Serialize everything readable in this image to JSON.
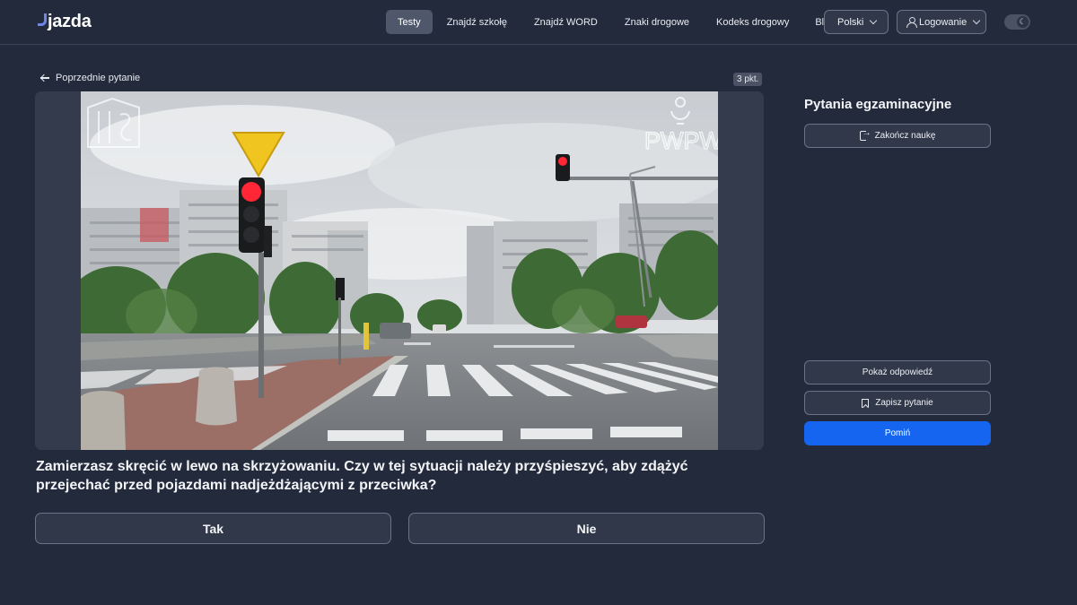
{
  "header": {
    "logo": "jazda",
    "nav": [
      {
        "label": "Testy",
        "active": true
      },
      {
        "label": "Znajdź szkołę"
      },
      {
        "label": "Znajdź WORD"
      },
      {
        "label": "Znaki drogowe"
      },
      {
        "label": "Kodeks drogowy"
      },
      {
        "label": "Blog"
      }
    ],
    "language": "Polski",
    "login": "Logowanie",
    "theme_icon": "moon-icon"
  },
  "question": {
    "prev_label": "Poprzednie pytanie",
    "points": "3 pkt.",
    "text": "Zamierzasz skręcić w lewo na skrzyżowaniu. Czy w tej sytuacji należy przyśpieszyć, aby zdążyć przejechać przed pojazdami nadjeżdżającymi z przeciwka?",
    "watermark_left": "ITS",
    "watermark_right": "PWPW",
    "answers": {
      "yes": "Tak",
      "no": "Nie"
    }
  },
  "sidebar": {
    "title": "Pytania egzaminacyjne",
    "finish": "Zakończ naukę",
    "show_answer": "Pokaż odpowiedź",
    "save_question": "Zapisz pytanie",
    "skip": "Pomiń"
  },
  "colors": {
    "background": "#222a3b",
    "primary": "#1565f0",
    "card": "#303849"
  }
}
